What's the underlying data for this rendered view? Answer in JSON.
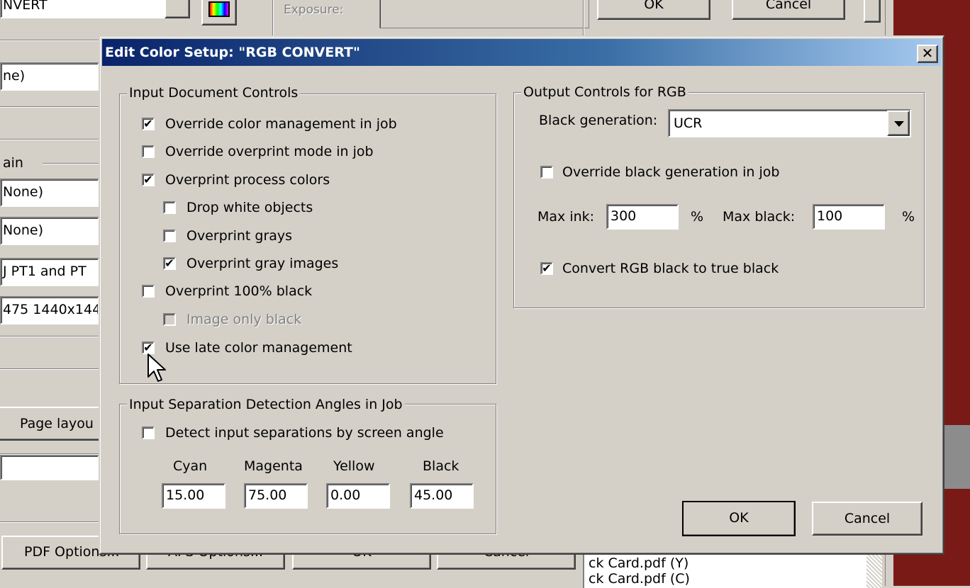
{
  "background": {
    "top_field_text": "NVERT",
    "exposure_label": "Exposure:",
    "top_ok": "OK",
    "top_cancel": "Cancel",
    "left_field1": "ne)",
    "domain_label": "ain",
    "left_field2": "None)",
    "left_field3": "None)",
    "left_field4": "J PT1 and PT",
    "left_field5": "475 1440x144",
    "page_layout_button": "Page layou",
    "pdf_options_button": "PDF Options...",
    "aps_options_button": "APS Options...",
    "bottom_ok": "OK",
    "bottom_cancel": "Cancel",
    "file_list": [
      "ck Card.pdf (Y)",
      "ck Card.pdf (C)"
    ]
  },
  "dialog": {
    "title": "Edit Color Setup: \"RGB CONVERT\"",
    "close_glyph": "✕",
    "input_controls": {
      "legend": "Input Document Controls",
      "items": [
        {
          "label": "Override color management in job",
          "checked": true,
          "disabled": false
        },
        {
          "label": "Override overprint mode in job",
          "checked": false,
          "disabled": false
        },
        {
          "label": "Overprint process colors",
          "checked": true,
          "disabled": false
        },
        {
          "label": "Drop white objects",
          "checked": false,
          "disabled": false
        },
        {
          "label": "Overprint grays",
          "checked": false,
          "disabled": false
        },
        {
          "label": "Overprint gray images",
          "checked": true,
          "disabled": false
        },
        {
          "label": "Overprint 100% black",
          "checked": false,
          "disabled": false
        },
        {
          "label": "Image only black",
          "checked": false,
          "disabled": true
        },
        {
          "label": "Use late color management",
          "checked": true,
          "disabled": false
        }
      ]
    },
    "separation": {
      "legend": "Input Separation Detection Angles in Job",
      "detect_label": "Detect input separations by screen angle",
      "detect_checked": false,
      "angles": [
        {
          "label": "Cyan",
          "value": "15.00"
        },
        {
          "label": "Magenta",
          "value": "75.00"
        },
        {
          "label": "Yellow",
          "value": "0.00"
        },
        {
          "label": "Black",
          "value": "45.00"
        }
      ]
    },
    "output": {
      "legend": "Output Controls for RGB",
      "black_generation_label": "Black generation:",
      "black_generation_value": "UCR",
      "override_black_label": "Override black generation in job",
      "override_black_checked": false,
      "max_ink_label": "Max ink:",
      "max_ink_value": "300",
      "max_ink_unit": "%",
      "max_black_label": "Max black:",
      "max_black_value": "100",
      "max_black_unit": "%",
      "convert_label": "Convert RGB black to true black",
      "convert_checked": true
    },
    "ok_button": "OK",
    "cancel_button": "Cancel"
  }
}
